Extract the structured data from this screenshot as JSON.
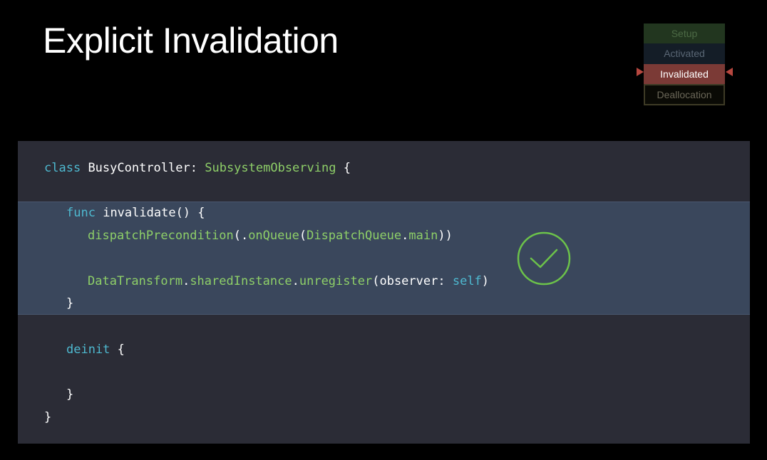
{
  "slide": {
    "title": "Explicit Invalidation"
  },
  "lifecycle": {
    "stages": [
      "Setup",
      "Activated",
      "Invalidated",
      "Deallocation"
    ],
    "current": "Invalidated"
  },
  "code": {
    "l1": {
      "kw": "class",
      "name": "BusyController",
      "colon": ":",
      "proto": "SubsystemObserving",
      "brace": "{"
    },
    "l2": {
      "kw": "func",
      "name": "invalidate",
      "rest": "() {"
    },
    "l3": {
      "fn": "dispatchPrecondition",
      "p1": "(.",
      "fn2": "onQueue",
      "p2": "(",
      "ty": "DispatchQueue",
      "dot": ".",
      "fn3": "main",
      "p3": "))"
    },
    "l4": {
      "ty": "DataTransform",
      "dot1": ".",
      "fn1": "sharedInstance",
      "dot2": ".",
      "fn2": "unregister",
      "p1": "(",
      "arg": "observer:",
      "sp": " ",
      "kw": "self",
      "p2": ")"
    },
    "l5": "}",
    "l6": {
      "kw": "deinit",
      "rest": " {"
    },
    "l7": "}",
    "l8": "}"
  },
  "colors": {
    "keyword": "#4eb9d0",
    "type": "#8ecf68",
    "highlight": "#3a475c",
    "panel": "#2b2c36",
    "check": "#6cc24a"
  },
  "icons": {
    "status": "checkmark-circle-icon"
  }
}
